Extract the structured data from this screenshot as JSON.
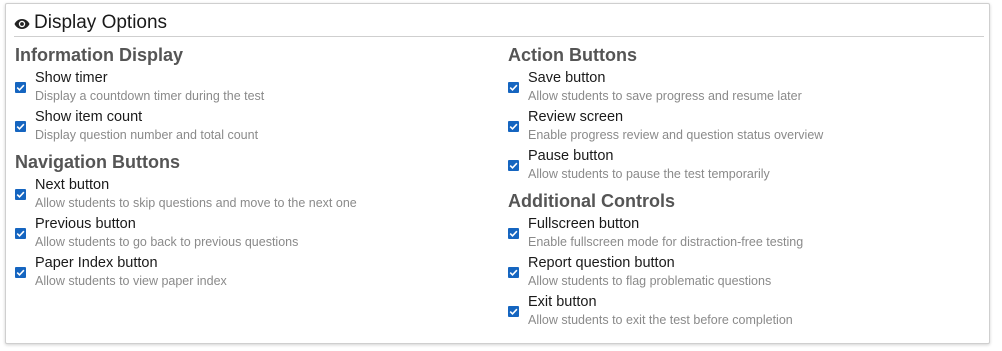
{
  "panel": {
    "title": "Display Options",
    "icon": "eye-icon"
  },
  "colors": {
    "checkbox": "#1565c0",
    "section_title": "#555555",
    "description": "#8a8a8a"
  },
  "left": {
    "sections": [
      {
        "title": "Information Display",
        "options": [
          {
            "label": "Show timer",
            "desc": "Display a countdown timer during the test",
            "checked": true
          },
          {
            "label": "Show item count",
            "desc": "Display question number and total count",
            "checked": true
          }
        ]
      },
      {
        "title": "Navigation Buttons",
        "options": [
          {
            "label": "Next button",
            "desc": "Allow students to skip questions and move to the next one",
            "checked": true
          },
          {
            "label": "Previous button",
            "desc": "Allow students to go back to previous questions",
            "checked": true
          },
          {
            "label": "Paper Index button",
            "desc": "Allow students to view paper index",
            "checked": true
          }
        ]
      }
    ]
  },
  "right": {
    "sections": [
      {
        "title": "Action Buttons",
        "options": [
          {
            "label": "Save button",
            "desc": "Allow students to save progress and resume later",
            "checked": true
          },
          {
            "label": "Review screen",
            "desc": "Enable progress review and question status overview",
            "checked": true
          },
          {
            "label": "Pause button",
            "desc": "Allow students to pause the test temporarily",
            "checked": true
          }
        ]
      },
      {
        "title": "Additional Controls",
        "options": [
          {
            "label": "Fullscreen button",
            "desc": "Enable fullscreen mode for distraction-free testing",
            "checked": true
          },
          {
            "label": "Report question button",
            "desc": "Allow students to flag problematic questions",
            "checked": true
          },
          {
            "label": "Exit button",
            "desc": "Allow students to exit the test before completion",
            "checked": true
          }
        ]
      }
    ]
  }
}
